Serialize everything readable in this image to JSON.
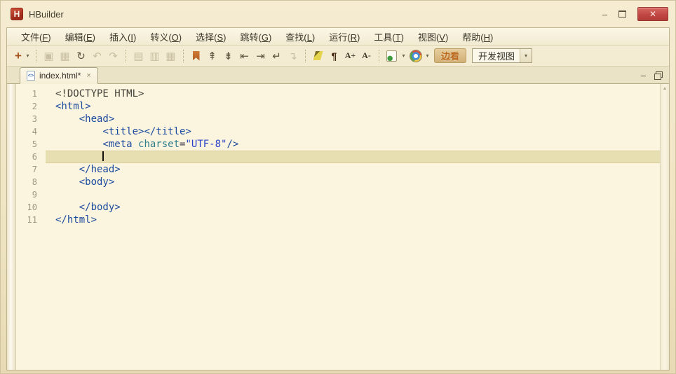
{
  "window": {
    "title": "HBuilder",
    "logo_letter": "H",
    "controls": {
      "minimize": "–",
      "close": "✕"
    }
  },
  "menu": {
    "items": [
      {
        "label": "文件",
        "key": "F"
      },
      {
        "label": "编辑",
        "key": "E"
      },
      {
        "label": "插入",
        "key": "I"
      },
      {
        "label": "转义",
        "key": "O"
      },
      {
        "label": "选择",
        "key": "S"
      },
      {
        "label": "跳转",
        "key": "G"
      },
      {
        "label": "查找",
        "key": "L"
      },
      {
        "label": "运行",
        "key": "R"
      },
      {
        "label": "工具",
        "key": "T"
      },
      {
        "label": "视图",
        "key": "V"
      },
      {
        "label": "帮助",
        "key": "H"
      }
    ]
  },
  "toolbar": {
    "items": [
      {
        "name": "new-file-icon",
        "glyph": "+",
        "cls": "plus"
      },
      {
        "name": "new-file-caret-icon",
        "glyph": "▾",
        "cls": "caret"
      },
      {
        "name": "separator"
      },
      {
        "name": "save-icon",
        "glyph": "▣",
        "disabled": true
      },
      {
        "name": "save-all-icon",
        "glyph": "▦",
        "disabled": true
      },
      {
        "name": "revert-file-icon",
        "glyph": "↻"
      },
      {
        "name": "undo-icon",
        "glyph": "↶",
        "disabled": true
      },
      {
        "name": "redo-icon",
        "glyph": "↷",
        "disabled": true
      },
      {
        "name": "separator"
      },
      {
        "name": "format-code-icon",
        "glyph": "▤",
        "disabled": true
      },
      {
        "name": "compress-code-icon",
        "glyph": "▥",
        "disabled": true
      },
      {
        "name": "format-selection-icon",
        "glyph": "▦",
        "disabled": true
      },
      {
        "name": "separator"
      },
      {
        "name": "bookmark-icon",
        "shape": "bookmark-shape"
      },
      {
        "name": "prev-bookmark-icon",
        "glyph": "⇞"
      },
      {
        "name": "next-bookmark-icon",
        "glyph": "⇟"
      },
      {
        "name": "jump-line-start-icon",
        "glyph": "⇤"
      },
      {
        "name": "jump-line-end-icon",
        "glyph": "⇥"
      },
      {
        "name": "last-edit-position-icon",
        "glyph": "↵"
      },
      {
        "name": "next-edit-position-icon",
        "glyph": "↴",
        "disabled": true
      },
      {
        "name": "separator"
      },
      {
        "name": "highlight-marker-icon",
        "shape": "marker-shape"
      },
      {
        "name": "show-paragraph-marks-icon",
        "glyph": "¶",
        "cls": "pilcrow"
      },
      {
        "name": "font-increase-icon",
        "glyph": "A+",
        "cls": "afont"
      },
      {
        "name": "font-decrease-icon",
        "glyph": "A-",
        "cls": "afont"
      },
      {
        "name": "separator"
      },
      {
        "name": "run-in-browser-icon",
        "shape": "runpage-shape"
      },
      {
        "name": "run-browser-caret-icon",
        "glyph": "▾",
        "cls": "caret"
      },
      {
        "name": "chrome-browser-icon",
        "shape": "chrome-shape"
      },
      {
        "name": "chrome-browser-caret-icon",
        "glyph": "▾",
        "cls": "caret"
      },
      {
        "name": "live-view-mode-button",
        "label": "边看",
        "cls": "btn-mode"
      },
      {
        "name": "view-select",
        "label": "开发视图",
        "caret": "▾"
      }
    ]
  },
  "tabbar": {
    "active_tab": {
      "label": "index.html*",
      "file_icon": "<>",
      "close": "×"
    },
    "pane_minimize": "–"
  },
  "editor": {
    "scroll_up_glyph": "▲",
    "cursor": {
      "line": 6,
      "col": 8
    },
    "lines": [
      {
        "n": 1,
        "segs": [
          {
            "t": "doctype",
            "s": "<!DOCTYPE HTML>"
          }
        ]
      },
      {
        "n": 2,
        "segs": [
          {
            "t": "tag",
            "s": "<html>"
          }
        ]
      },
      {
        "n": 3,
        "segs": [
          {
            "t": "sp",
            "s": "    "
          },
          {
            "t": "tag",
            "s": "<head>"
          }
        ]
      },
      {
        "n": 4,
        "segs": [
          {
            "t": "sp",
            "s": "        "
          },
          {
            "t": "tag",
            "s": "<title></title>"
          }
        ]
      },
      {
        "n": 5,
        "segs": [
          {
            "t": "sp",
            "s": "        "
          },
          {
            "t": "tag",
            "s": "<meta "
          },
          {
            "t": "attr",
            "s": "charset"
          },
          {
            "t": "op",
            "s": "="
          },
          {
            "t": "str",
            "s": "\"UTF-8\""
          },
          {
            "t": "tag",
            "s": "/>"
          }
        ]
      },
      {
        "n": 6,
        "current": true,
        "segs": [
          {
            "t": "sp",
            "s": "        "
          }
        ]
      },
      {
        "n": 7,
        "segs": [
          {
            "t": "sp",
            "s": "    "
          },
          {
            "t": "tag",
            "s": "</head>"
          }
        ]
      },
      {
        "n": 8,
        "segs": [
          {
            "t": "sp",
            "s": "    "
          },
          {
            "t": "tag",
            "s": "<body>"
          }
        ]
      },
      {
        "n": 9,
        "segs": []
      },
      {
        "n": 10,
        "segs": [
          {
            "t": "sp",
            "s": "    "
          },
          {
            "t": "tag",
            "s": "</body>"
          }
        ]
      },
      {
        "n": 11,
        "segs": [
          {
            "t": "tag",
            "s": "</html>"
          }
        ]
      }
    ]
  },
  "colors": {
    "frame_bg": "#efe4c2",
    "editor_bg": "#fbf5e0",
    "current_line_bg": "#e7deb2",
    "close_button": "#c04742",
    "bookmark": "#b05a1f",
    "tag": "#1c4a9e",
    "attr": "#2e7d8c",
    "string": "#2a41c8",
    "line_number": "#9d9880"
  }
}
